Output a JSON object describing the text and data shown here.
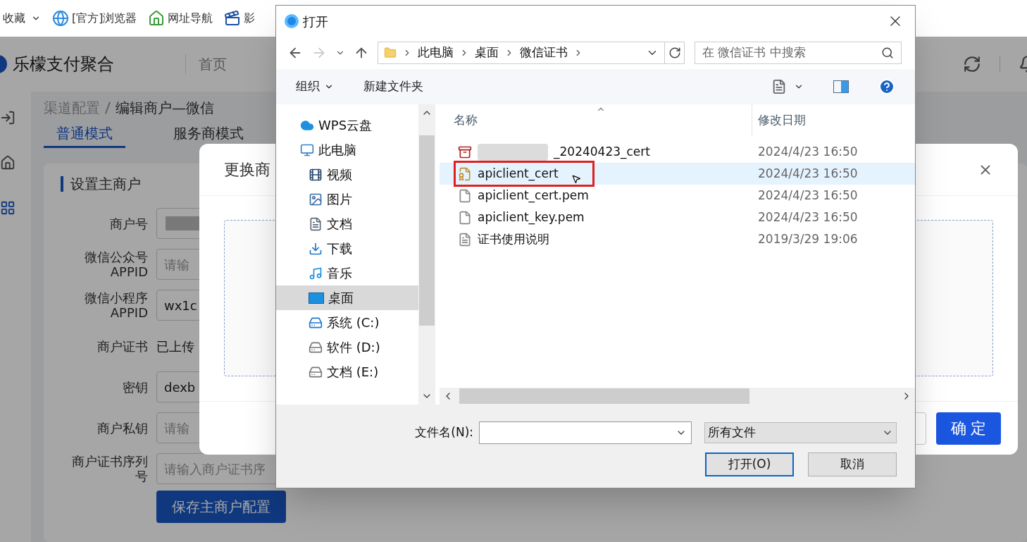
{
  "bookmarks_bar": {
    "items": [
      {
        "label": "收藏",
        "kind": "menu"
      },
      {
        "label": "[官方]浏览器",
        "kind": "browser"
      },
      {
        "label": "网址导航",
        "kind": "nav"
      },
      {
        "label": "影",
        "kind": "video"
      }
    ]
  },
  "app": {
    "brand": "乐檬支付聚合",
    "top_nav": [
      {
        "label": "首页"
      }
    ],
    "breadcrumb": [
      "渠道配置",
      "编辑商户—微信"
    ],
    "tabs": [
      {
        "label": "普通模式",
        "selected": true
      },
      {
        "label": "服务商模式",
        "selected": false
      }
    ],
    "section_title": "设置主商户",
    "form": [
      {
        "label": "商户号",
        "kind": "masked"
      },
      {
        "label": "微信公众号 APPID",
        "kind": "input",
        "placeholder": "请输"
      },
      {
        "label": "微信小程序 APPID",
        "kind": "input",
        "value": "wx1c"
      },
      {
        "label": "商户证书",
        "kind": "text",
        "value": "已上传"
      },
      {
        "label": "密钥",
        "kind": "input",
        "value": "dexb"
      },
      {
        "label": "商户私钥",
        "kind": "input",
        "placeholder": "请输"
      },
      {
        "label": "商户证书序列号",
        "kind": "input",
        "placeholder": "请输入商户证书序"
      }
    ],
    "save_button": "保存主商户配置"
  },
  "modal": {
    "title": "更换商",
    "confirm_button": "确 定"
  },
  "file_dialog": {
    "title": "打开",
    "path": [
      "此电脑",
      "桌面",
      "微信证书"
    ],
    "search": {
      "placeholder": "在 微信证书 中搜索"
    },
    "toolbar": [
      "组织",
      "新建文件夹"
    ],
    "nav": [
      {
        "label": "WPS云盘",
        "kind": "cloud",
        "selected": false
      },
      {
        "label": "此电脑",
        "kind": "pc",
        "selected": false,
        "children": [
          {
            "label": "视频",
            "kind": "video",
            "selected": false
          },
          {
            "label": "图片",
            "kind": "image",
            "selected": false
          },
          {
            "label": "文档",
            "kind": "doc",
            "selected": false
          },
          {
            "label": "下载",
            "kind": "download",
            "selected": false
          },
          {
            "label": "音乐",
            "kind": "music",
            "selected": false
          },
          {
            "label": "桌面",
            "kind": "desktop",
            "selected": true
          },
          {
            "label": "系统 (C:)",
            "kind": "system-drive",
            "selected": false
          },
          {
            "label": "软件 (D:)",
            "kind": "drive",
            "selected": false
          },
          {
            "label": "文档 (E:)",
            "kind": "drive",
            "selected": false
          }
        ]
      }
    ],
    "columns": [
      "名称",
      "修改日期"
    ],
    "files": [
      {
        "name": "_20240423_cert",
        "kind": "archive",
        "masked": true,
        "date": "2024/4/23 16:50",
        "selected": false,
        "annotated": false
      },
      {
        "name": "apiclient_cert",
        "kind": "cert",
        "masked": false,
        "date": "2024/4/23 16:50",
        "selected": true,
        "annotated": true
      },
      {
        "name": "apiclient_cert.pem",
        "kind": "file",
        "masked": false,
        "date": "2024/4/23 16:50",
        "selected": false,
        "annotated": false
      },
      {
        "name": "apiclient_key.pem",
        "kind": "file",
        "masked": false,
        "date": "2024/4/23 16:50",
        "selected": false,
        "annotated": false
      },
      {
        "name": "证书使用说明",
        "kind": "doc",
        "masked": false,
        "date": "2019/3/29 19:06",
        "selected": false,
        "annotated": false
      }
    ],
    "filename_label": "文件名(N):",
    "file_type": "所有文件",
    "open_button": "打开(O)",
    "cancel_button": "取消"
  }
}
